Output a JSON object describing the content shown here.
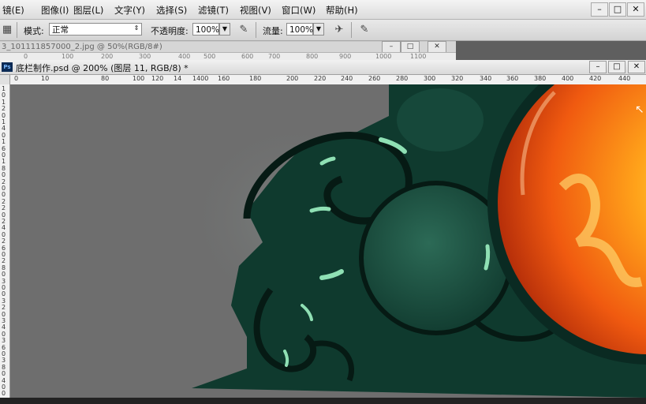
{
  "menu": {
    "items": [
      "镜(E)",
      "图像(I)",
      "图层(L)",
      "文字(Y)",
      "选择(S)",
      "滤镜(T)",
      "视图(V)",
      "窗口(W)",
      "帮助(H)"
    ],
    "win_min": "–",
    "win_max": "□",
    "win_close": "✕"
  },
  "options": {
    "mode_label": "模式:",
    "mode_value": "正常",
    "opacity_label": "不透明度:",
    "opacity_value": "100%",
    "flow_label": "流量:",
    "flow_value": "100%"
  },
  "doc1": {
    "title": "3_101111857000_2.jpg @ 50%(RGB/8#)",
    "ruler_ticks": [
      "0",
      "100",
      "200",
      "300",
      "400",
      "500",
      "600",
      "700",
      "800",
      "900",
      "1000",
      "1100"
    ]
  },
  "doc2": {
    "title": "底栏制作.psd @ 200% (图层 11, RGB/8) *",
    "ruler_ticks": [
      "0",
      "10",
      "80",
      "100",
      "120",
      "14",
      "1400",
      "160",
      "180",
      "200",
      "220",
      "240",
      "260",
      "280",
      "300",
      "320",
      "340",
      "360",
      "380",
      "400",
      "420",
      "440"
    ],
    "vruler_ticks": [
      "1",
      "0",
      "1",
      "2",
      "0",
      "1",
      "4",
      "0",
      "1",
      "6",
      "0",
      "1",
      "8",
      "0",
      "2",
      "0",
      "0",
      "2",
      "2",
      "0",
      "2",
      "4",
      "0",
      "2",
      "6",
      "0",
      "2",
      "8",
      "0",
      "3",
      "0",
      "0",
      "3",
      "2",
      "0",
      "3",
      "4",
      "0",
      "3",
      "6",
      "0",
      "3",
      "8",
      "0",
      "4",
      "0",
      "0"
    ]
  },
  "colors": {
    "canvas_bg": "#6e6e6e",
    "jade_dark": "#0c2a22",
    "jade": "#1f5a48",
    "jade_highlight": "#8fe0b4",
    "fire": "#ff7a10",
    "fire_light": "#ffd23a"
  }
}
